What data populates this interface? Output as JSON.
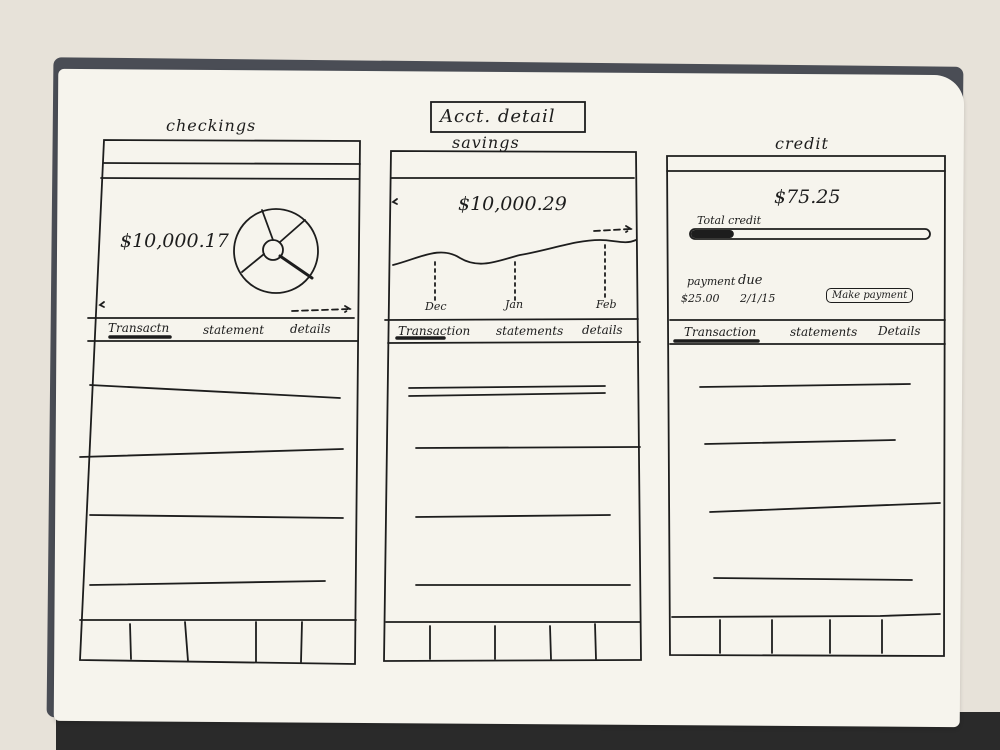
{
  "header": {
    "title": "Acct. detail"
  },
  "screens": [
    {
      "heading": "checkings",
      "balance": "$10,000.17",
      "tabs": [
        "Transactn",
        "statement",
        "details"
      ]
    },
    {
      "heading": "savings",
      "balance": "$10,000.29",
      "chart_labels": [
        "Dec",
        "Jan",
        "Feb"
      ],
      "tabs": [
        "Transaction",
        "statements",
        "details"
      ]
    },
    {
      "heading": "credit",
      "balance": "$75.25",
      "credit_label": "Total credit",
      "credit_used_fraction": 0.18,
      "payment_label": "payment",
      "due_label": "due",
      "payment_amount": "$25.00",
      "due_date": "2/1/15",
      "make_payment_label": "Make payment",
      "tabs": [
        "Transaction",
        "statements",
        "Details"
      ]
    }
  ],
  "colors": {
    "ink": "#1d1d1d",
    "paper": "#f6f4ed"
  }
}
